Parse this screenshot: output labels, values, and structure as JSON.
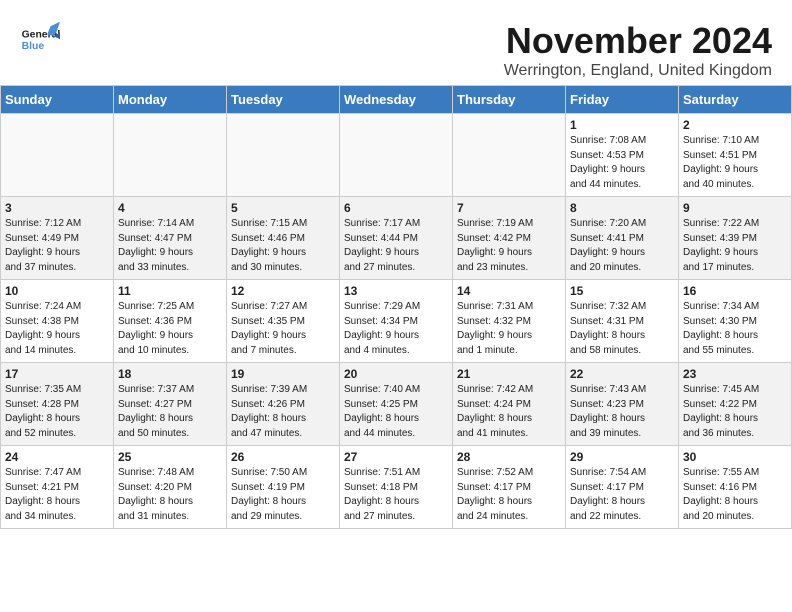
{
  "header": {
    "logo_general": "General",
    "logo_blue": "Blue",
    "month_title": "November 2024",
    "location": "Werrington, England, United Kingdom"
  },
  "weekdays": [
    "Sunday",
    "Monday",
    "Tuesday",
    "Wednesday",
    "Thursday",
    "Friday",
    "Saturday"
  ],
  "weeks": [
    [
      {
        "day": "",
        "info": ""
      },
      {
        "day": "",
        "info": ""
      },
      {
        "day": "",
        "info": ""
      },
      {
        "day": "",
        "info": ""
      },
      {
        "day": "",
        "info": ""
      },
      {
        "day": "1",
        "info": "Sunrise: 7:08 AM\nSunset: 4:53 PM\nDaylight: 9 hours\nand 44 minutes."
      },
      {
        "day": "2",
        "info": "Sunrise: 7:10 AM\nSunset: 4:51 PM\nDaylight: 9 hours\nand 40 minutes."
      }
    ],
    [
      {
        "day": "3",
        "info": "Sunrise: 7:12 AM\nSunset: 4:49 PM\nDaylight: 9 hours\nand 37 minutes."
      },
      {
        "day": "4",
        "info": "Sunrise: 7:14 AM\nSunset: 4:47 PM\nDaylight: 9 hours\nand 33 minutes."
      },
      {
        "day": "5",
        "info": "Sunrise: 7:15 AM\nSunset: 4:46 PM\nDaylight: 9 hours\nand 30 minutes."
      },
      {
        "day": "6",
        "info": "Sunrise: 7:17 AM\nSunset: 4:44 PM\nDaylight: 9 hours\nand 27 minutes."
      },
      {
        "day": "7",
        "info": "Sunrise: 7:19 AM\nSunset: 4:42 PM\nDaylight: 9 hours\nand 23 minutes."
      },
      {
        "day": "8",
        "info": "Sunrise: 7:20 AM\nSunset: 4:41 PM\nDaylight: 9 hours\nand 20 minutes."
      },
      {
        "day": "9",
        "info": "Sunrise: 7:22 AM\nSunset: 4:39 PM\nDaylight: 9 hours\nand 17 minutes."
      }
    ],
    [
      {
        "day": "10",
        "info": "Sunrise: 7:24 AM\nSunset: 4:38 PM\nDaylight: 9 hours\nand 14 minutes."
      },
      {
        "day": "11",
        "info": "Sunrise: 7:25 AM\nSunset: 4:36 PM\nDaylight: 9 hours\nand 10 minutes."
      },
      {
        "day": "12",
        "info": "Sunrise: 7:27 AM\nSunset: 4:35 PM\nDaylight: 9 hours\nand 7 minutes."
      },
      {
        "day": "13",
        "info": "Sunrise: 7:29 AM\nSunset: 4:34 PM\nDaylight: 9 hours\nand 4 minutes."
      },
      {
        "day": "14",
        "info": "Sunrise: 7:31 AM\nSunset: 4:32 PM\nDaylight: 9 hours\nand 1 minute."
      },
      {
        "day": "15",
        "info": "Sunrise: 7:32 AM\nSunset: 4:31 PM\nDaylight: 8 hours\nand 58 minutes."
      },
      {
        "day": "16",
        "info": "Sunrise: 7:34 AM\nSunset: 4:30 PM\nDaylight: 8 hours\nand 55 minutes."
      }
    ],
    [
      {
        "day": "17",
        "info": "Sunrise: 7:35 AM\nSunset: 4:28 PM\nDaylight: 8 hours\nand 52 minutes."
      },
      {
        "day": "18",
        "info": "Sunrise: 7:37 AM\nSunset: 4:27 PM\nDaylight: 8 hours\nand 50 minutes."
      },
      {
        "day": "19",
        "info": "Sunrise: 7:39 AM\nSunset: 4:26 PM\nDaylight: 8 hours\nand 47 minutes."
      },
      {
        "day": "20",
        "info": "Sunrise: 7:40 AM\nSunset: 4:25 PM\nDaylight: 8 hours\nand 44 minutes."
      },
      {
        "day": "21",
        "info": "Sunrise: 7:42 AM\nSunset: 4:24 PM\nDaylight: 8 hours\nand 41 minutes."
      },
      {
        "day": "22",
        "info": "Sunrise: 7:43 AM\nSunset: 4:23 PM\nDaylight: 8 hours\nand 39 minutes."
      },
      {
        "day": "23",
        "info": "Sunrise: 7:45 AM\nSunset: 4:22 PM\nDaylight: 8 hours\nand 36 minutes."
      }
    ],
    [
      {
        "day": "24",
        "info": "Sunrise: 7:47 AM\nSunset: 4:21 PM\nDaylight: 8 hours\nand 34 minutes."
      },
      {
        "day": "25",
        "info": "Sunrise: 7:48 AM\nSunset: 4:20 PM\nDaylight: 8 hours\nand 31 minutes."
      },
      {
        "day": "26",
        "info": "Sunrise: 7:50 AM\nSunset: 4:19 PM\nDaylight: 8 hours\nand 29 minutes."
      },
      {
        "day": "27",
        "info": "Sunrise: 7:51 AM\nSunset: 4:18 PM\nDaylight: 8 hours\nand 27 minutes."
      },
      {
        "day": "28",
        "info": "Sunrise: 7:52 AM\nSunset: 4:17 PM\nDaylight: 8 hours\nand 24 minutes."
      },
      {
        "day": "29",
        "info": "Sunrise: 7:54 AM\nSunset: 4:17 PM\nDaylight: 8 hours\nand 22 minutes."
      },
      {
        "day": "30",
        "info": "Sunrise: 7:55 AM\nSunset: 4:16 PM\nDaylight: 8 hours\nand 20 minutes."
      }
    ]
  ]
}
